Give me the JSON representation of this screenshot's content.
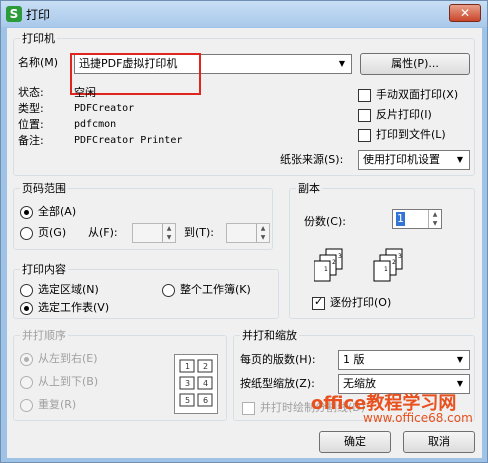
{
  "window": {
    "title": "打印",
    "app_icon": "S",
    "close_glyph": "✕"
  },
  "printer": {
    "group_title": "打印机",
    "name_label": "名称(M)",
    "name_value": "迅捷PDF虚拟打印机",
    "properties_button": "属性(P)...",
    "status_label": "状态:",
    "status_value": "空闲",
    "type_label": "类型:",
    "type_value": "PDFCreator",
    "location_label": "位置:",
    "location_value": "pdfcmon",
    "comment_label": "备注:",
    "comment_value": "PDFCreator Printer",
    "manual_duplex": "手动双面打印(X)",
    "reverse_print": "反片打印(I)",
    "print_to_file": "打印到文件(L)",
    "paper_source_label": "纸张来源(S):",
    "paper_source_value": "使用打印机设置"
  },
  "page_range": {
    "group_title": "页码范围",
    "all": "全部(A)",
    "pages": "页(G)",
    "from_label": "从(F):",
    "to_label": "到(T):"
  },
  "copies": {
    "group_title": "副本",
    "count_label": "份数(C):",
    "count_value": "1",
    "collate": "逐份打印(O)",
    "stack_pages": [
      "1",
      "2",
      "3"
    ]
  },
  "print_content": {
    "group_title": "打印内容",
    "selection": "选定区域(N)",
    "entire_workbook": "整个工作簿(K)",
    "active_sheets": "选定工作表(V)"
  },
  "print_order": {
    "group_title": "并打顺序",
    "left_to_right": "从左到右(E)",
    "top_to_bottom": "从上到下(B)",
    "repeat": "重复(R)",
    "grid_cells": [
      "1",
      "2",
      "3",
      "4",
      "5",
      "6"
    ]
  },
  "scaling": {
    "group_title": "并打和缩放",
    "pages_per_sheet_label": "每页的版数(H):",
    "pages_per_sheet_value": "1 版",
    "scale_label": "按纸型缩放(Z):",
    "scale_value": "无缩放",
    "draw_borders": "并打时绘制分割线(D)"
  },
  "footer": {
    "ok_button": "确定",
    "cancel_button": "取消"
  },
  "watermark": {
    "main": "office教程学习网",
    "sub": "www.office68.com"
  },
  "colors": {
    "highlight": "#e0261c",
    "watermark": "#e8501e",
    "selection": "#3375d6"
  }
}
